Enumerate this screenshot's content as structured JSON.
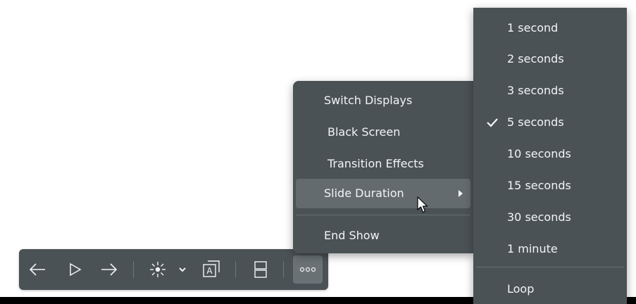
{
  "toolbar": {
    "buttons": [
      {
        "name": "previous-slide-button",
        "icon": "arrow-left-icon"
      },
      {
        "name": "play-button",
        "icon": "play-icon"
      },
      {
        "name": "next-slide-button",
        "icon": "arrow-right-icon"
      },
      {
        "name": "laser-pointer-button",
        "icon": "laser-pointer-icon"
      },
      {
        "name": "pointer-options-button",
        "icon": "chevron-down-icon"
      },
      {
        "name": "text-tool-button",
        "icon": "text-box-icon"
      },
      {
        "name": "layout-button",
        "icon": "split-view-icon"
      },
      {
        "name": "more-button",
        "icon": "more-horizontal-icon"
      }
    ]
  },
  "main_menu": {
    "items": [
      {
        "label": "Switch Displays"
      },
      {
        "label": "Black Screen"
      },
      {
        "label": "Transition Effects"
      },
      {
        "label": "Slide Duration",
        "has_submenu": true,
        "highlighted": true
      },
      {
        "label": "End Show"
      }
    ]
  },
  "duration_menu": {
    "items": [
      {
        "label": "1 second"
      },
      {
        "label": "2 seconds"
      },
      {
        "label": "3 seconds"
      },
      {
        "label": "5 seconds",
        "checked": true
      },
      {
        "label": "10 seconds"
      },
      {
        "label": "15 seconds"
      },
      {
        "label": "30 seconds"
      },
      {
        "label": "1 minute"
      },
      {
        "label": "Loop"
      }
    ],
    "selected": "5 seconds"
  },
  "colors": {
    "menu_bg": "#4b5256",
    "highlight": "#636b6f",
    "text": "#f2f4f5",
    "page_bg": "#ffffff"
  }
}
